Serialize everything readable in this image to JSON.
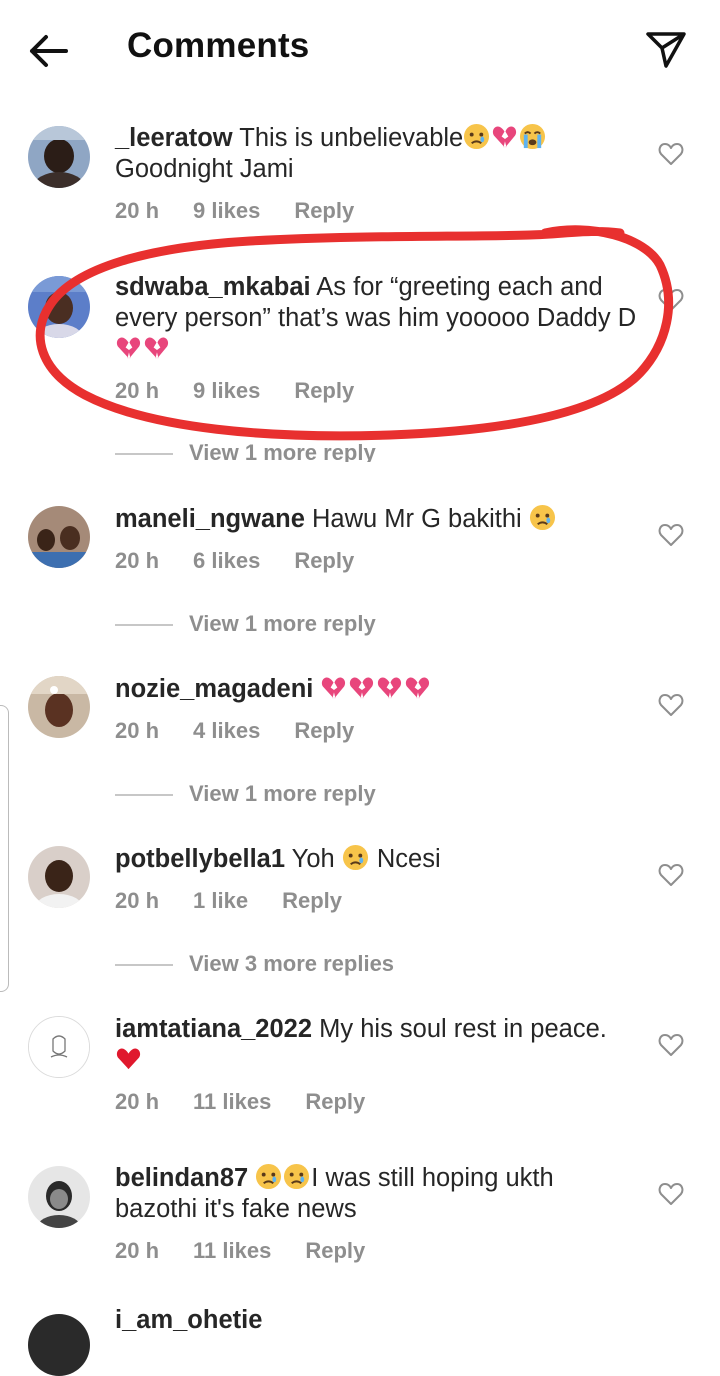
{
  "header": {
    "title": "Comments",
    "back_icon": "arrow-left-icon",
    "send_icon": "paper-plane-icon"
  },
  "comments": [
    {
      "username": "_leeratow",
      "text": "This is unbelievable",
      "emojis": [
        "crying-face",
        "broken-heart",
        "loudly-crying-face"
      ],
      "text2": "Goodnight Jami",
      "time": "20 h",
      "likes": "9 likes",
      "reply": "Reply"
    },
    {
      "username": "sdwaba_mkabai",
      "text": "As for “greeting each and every person” that’s was him yooooo Daddy D",
      "emojis": [
        "broken-heart",
        "broken-heart"
      ],
      "time": "20 h",
      "likes": "9 likes",
      "reply": "Reply",
      "view_more": "View 1 more reply"
    },
    {
      "username": "maneli_ngwane",
      "text": "Hawu Mr G bakithi ",
      "emojis": [
        "crying-face"
      ],
      "time": "20 h",
      "likes": "6 likes",
      "reply": "Reply",
      "view_more": "View 1 more reply"
    },
    {
      "username": "nozie_magadeni",
      "text": "",
      "emojis": [
        "broken-heart",
        "broken-heart",
        "broken-heart",
        "broken-heart"
      ],
      "time": "20 h",
      "likes": "4 likes",
      "reply": "Reply",
      "view_more": "View 1 more reply"
    },
    {
      "username": "potbellybella1",
      "text": "Yoh ",
      "emojis": [
        "crying-face"
      ],
      "text2": " Ncesi",
      "time": "20 h",
      "likes": "1 like",
      "reply": "Reply",
      "view_more": "View 3 more replies"
    },
    {
      "username": "iamtatiana_2022",
      "text": "My his soul rest in peace.",
      "emojis": [
        "red-heart"
      ],
      "time": "20 h",
      "likes": "11 likes",
      "reply": "Reply"
    },
    {
      "username": "belindan87",
      "text": "I was still hoping ukth bazothi it's fake news",
      "emojis": [
        "crying-face",
        "crying-face"
      ],
      "time": "20 h",
      "likes": "11 likes",
      "reply": "Reply"
    }
  ],
  "partial_next_username": "i_am_ohetie",
  "annotation_color": "#e8302f",
  "muted_text_color": "#8e8e8e",
  "heart_icon": "heart-outline-icon"
}
